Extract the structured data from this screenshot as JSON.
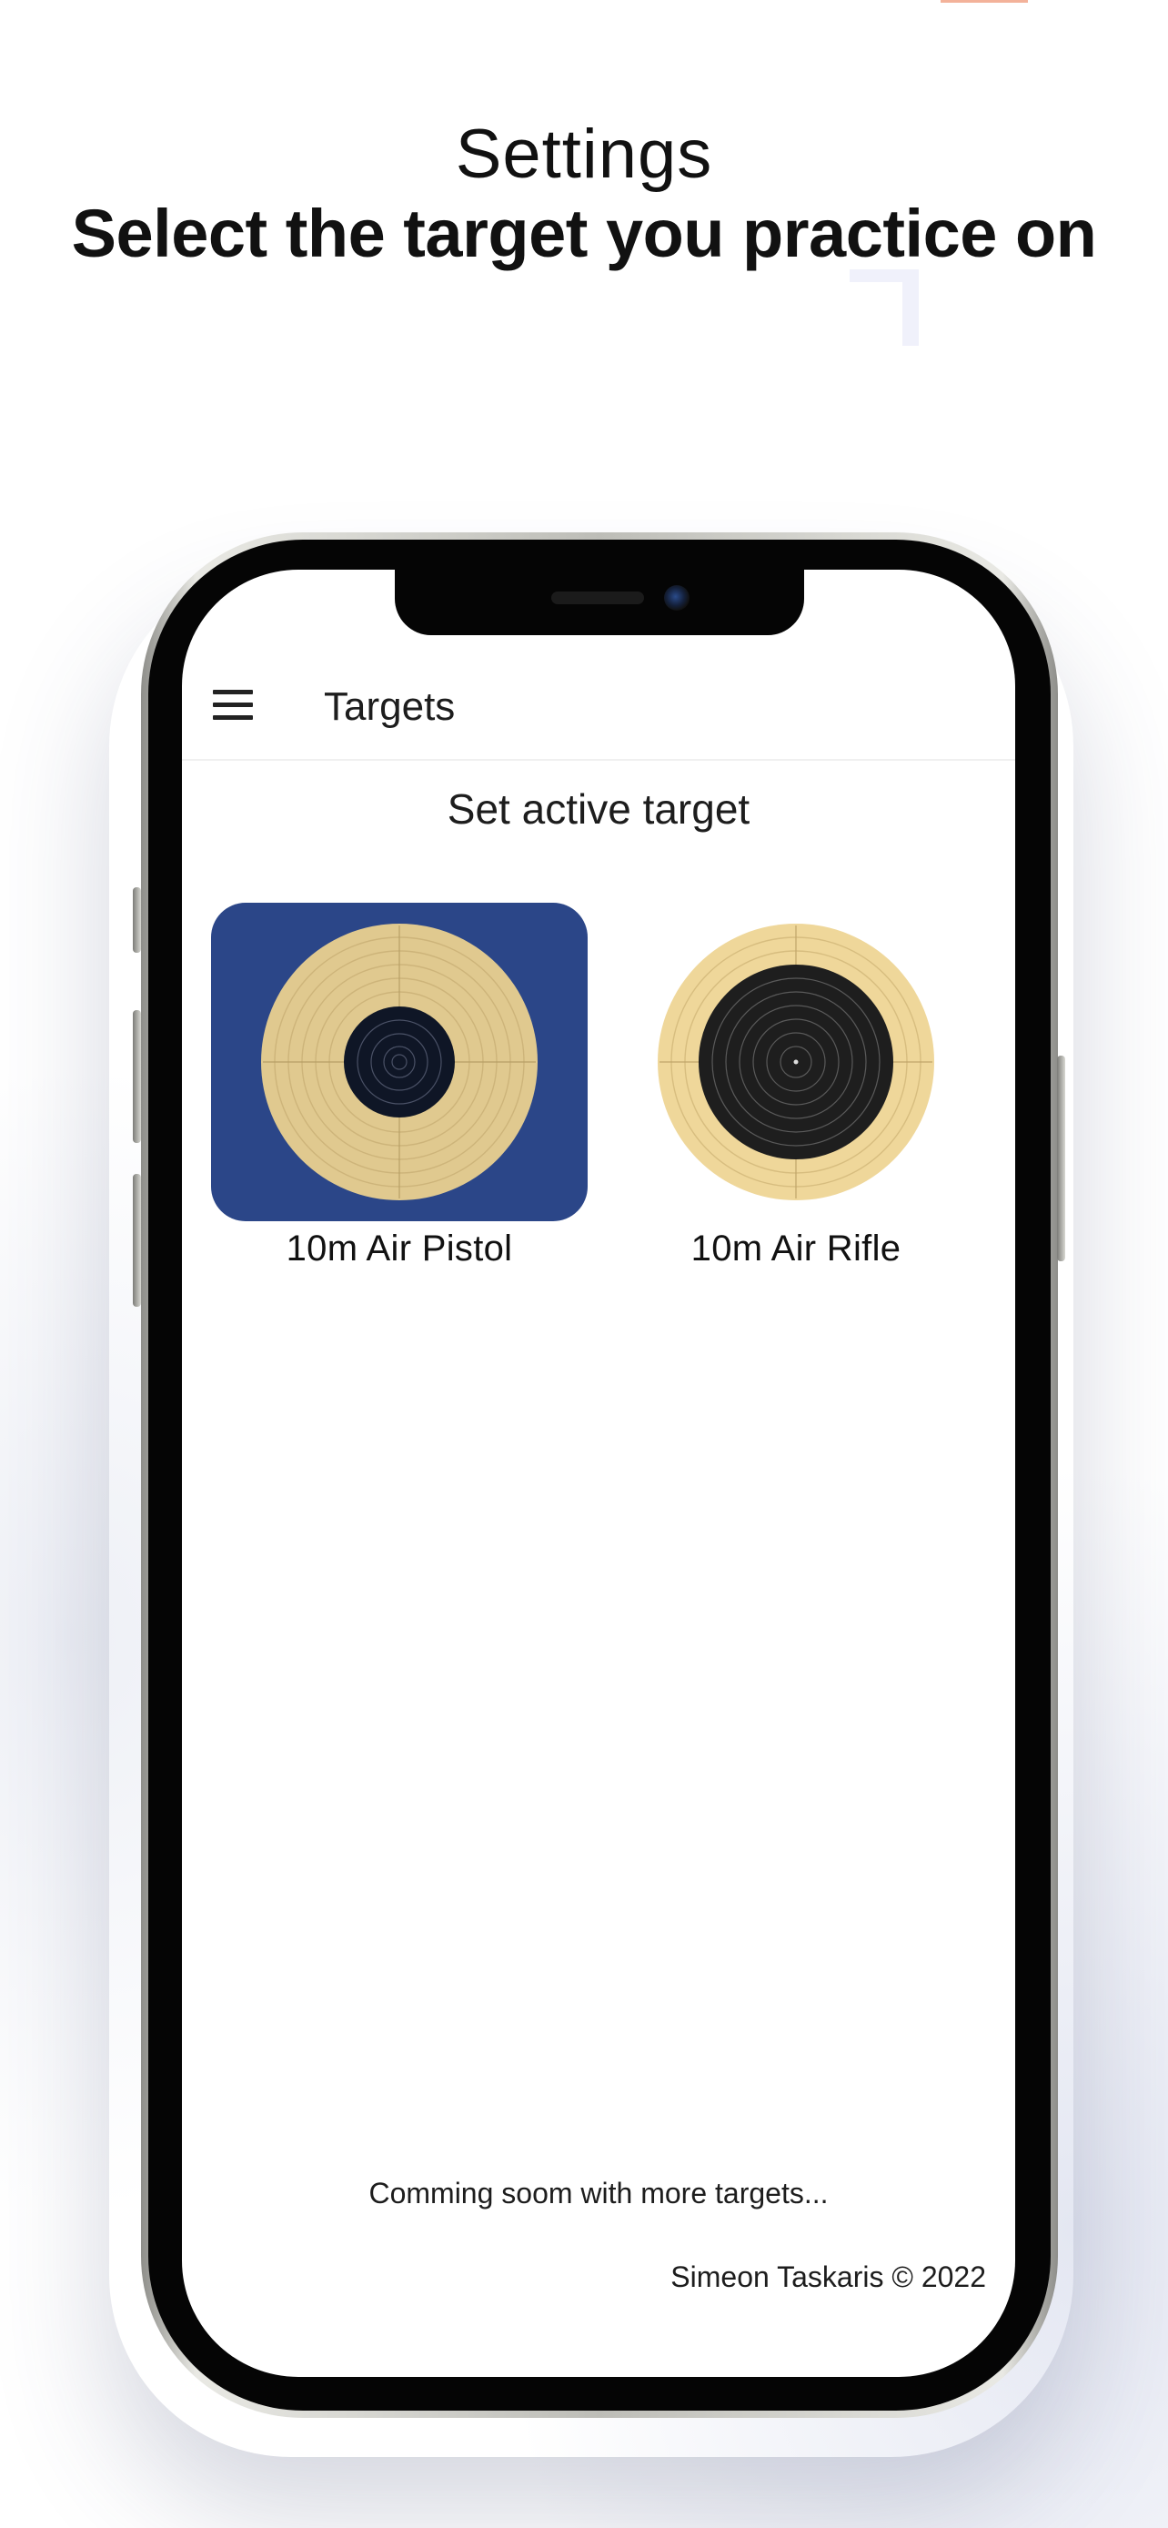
{
  "headline": {
    "title": "Settings",
    "subtitle": "Select the target you practice on"
  },
  "app": {
    "appbar_title": "Targets",
    "section_title": "Set active target",
    "targets": [
      {
        "label": "10m Air Pistol",
        "selected": true,
        "selected_bg": "#2b4688",
        "face_color": "#e0c98f",
        "black_color": "#0f1626"
      },
      {
        "label": "10m Air Rifle",
        "selected": false,
        "face_color": "#efd79a",
        "black_color": "#1e1e1e"
      }
    ],
    "coming_soon": "Comming soom with more targets...",
    "copyright": "Simeon Taskaris © 2022"
  },
  "icons": {
    "menu": "hamburger-menu-icon"
  }
}
